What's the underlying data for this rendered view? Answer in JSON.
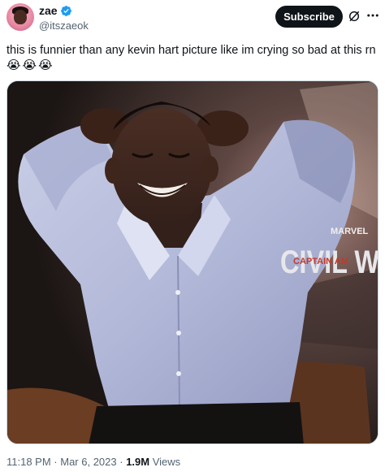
{
  "author": {
    "display_name": "zae",
    "handle": "@itszaeok",
    "verified": true
  },
  "header": {
    "subscribe_label": "Subscribe",
    "grok_icon": "grok-icon",
    "more_icon": "more-options-icon"
  },
  "tweet": {
    "text": "this is funnier than any kevin hart picture like im crying so bad at this rn",
    "emojis": [
      "😭",
      "😭",
      "😭"
    ]
  },
  "media": {
    "poster_brand": "MARVEL",
    "poster_title": "CIVIL W",
    "poster_subtitle": "CAPTAIN AM"
  },
  "meta": {
    "time": "11:18 PM",
    "separator": " · ",
    "date": "Mar 6, 2023",
    "views_count": "1.9M",
    "views_label": "Views"
  },
  "colors": {
    "verified_blue": "#1d9bf0",
    "subscribe_bg": "#0f1419",
    "secondary_text": "#536471"
  }
}
